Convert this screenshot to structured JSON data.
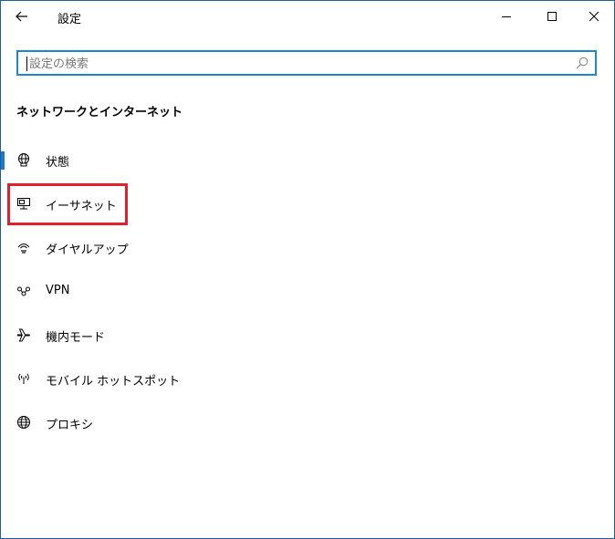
{
  "window": {
    "title": "設定",
    "border_color": "#1f5f9a"
  },
  "titlebar": {
    "back_icon": "arrow-left-icon",
    "minimize_icon": "minimize-icon",
    "maximize_icon": "maximize-icon",
    "close_icon": "close-icon"
  },
  "search": {
    "placeholder": "設定の検索",
    "value": "",
    "icon": "search-icon",
    "border_color": "#1c86d0"
  },
  "section": {
    "heading": "ネットワークとインターネット"
  },
  "nav": {
    "accent_color": "#1c78c8",
    "highlight_color": "#e0202b",
    "active_index": 0,
    "highlighted_index": 1,
    "items": [
      {
        "label": "状態",
        "icon": "globe-network-icon"
      },
      {
        "label": "イーサネット",
        "icon": "ethernet-icon"
      },
      {
        "label": "ダイヤルアップ",
        "icon": "dialup-icon"
      },
      {
        "label": "VPN",
        "icon": "vpn-icon"
      },
      {
        "label": "機内モード",
        "icon": "airplane-icon"
      },
      {
        "label": "モバイル ホットスポット",
        "icon": "hotspot-icon"
      },
      {
        "label": "プロキシ",
        "icon": "globe-icon"
      }
    ]
  }
}
